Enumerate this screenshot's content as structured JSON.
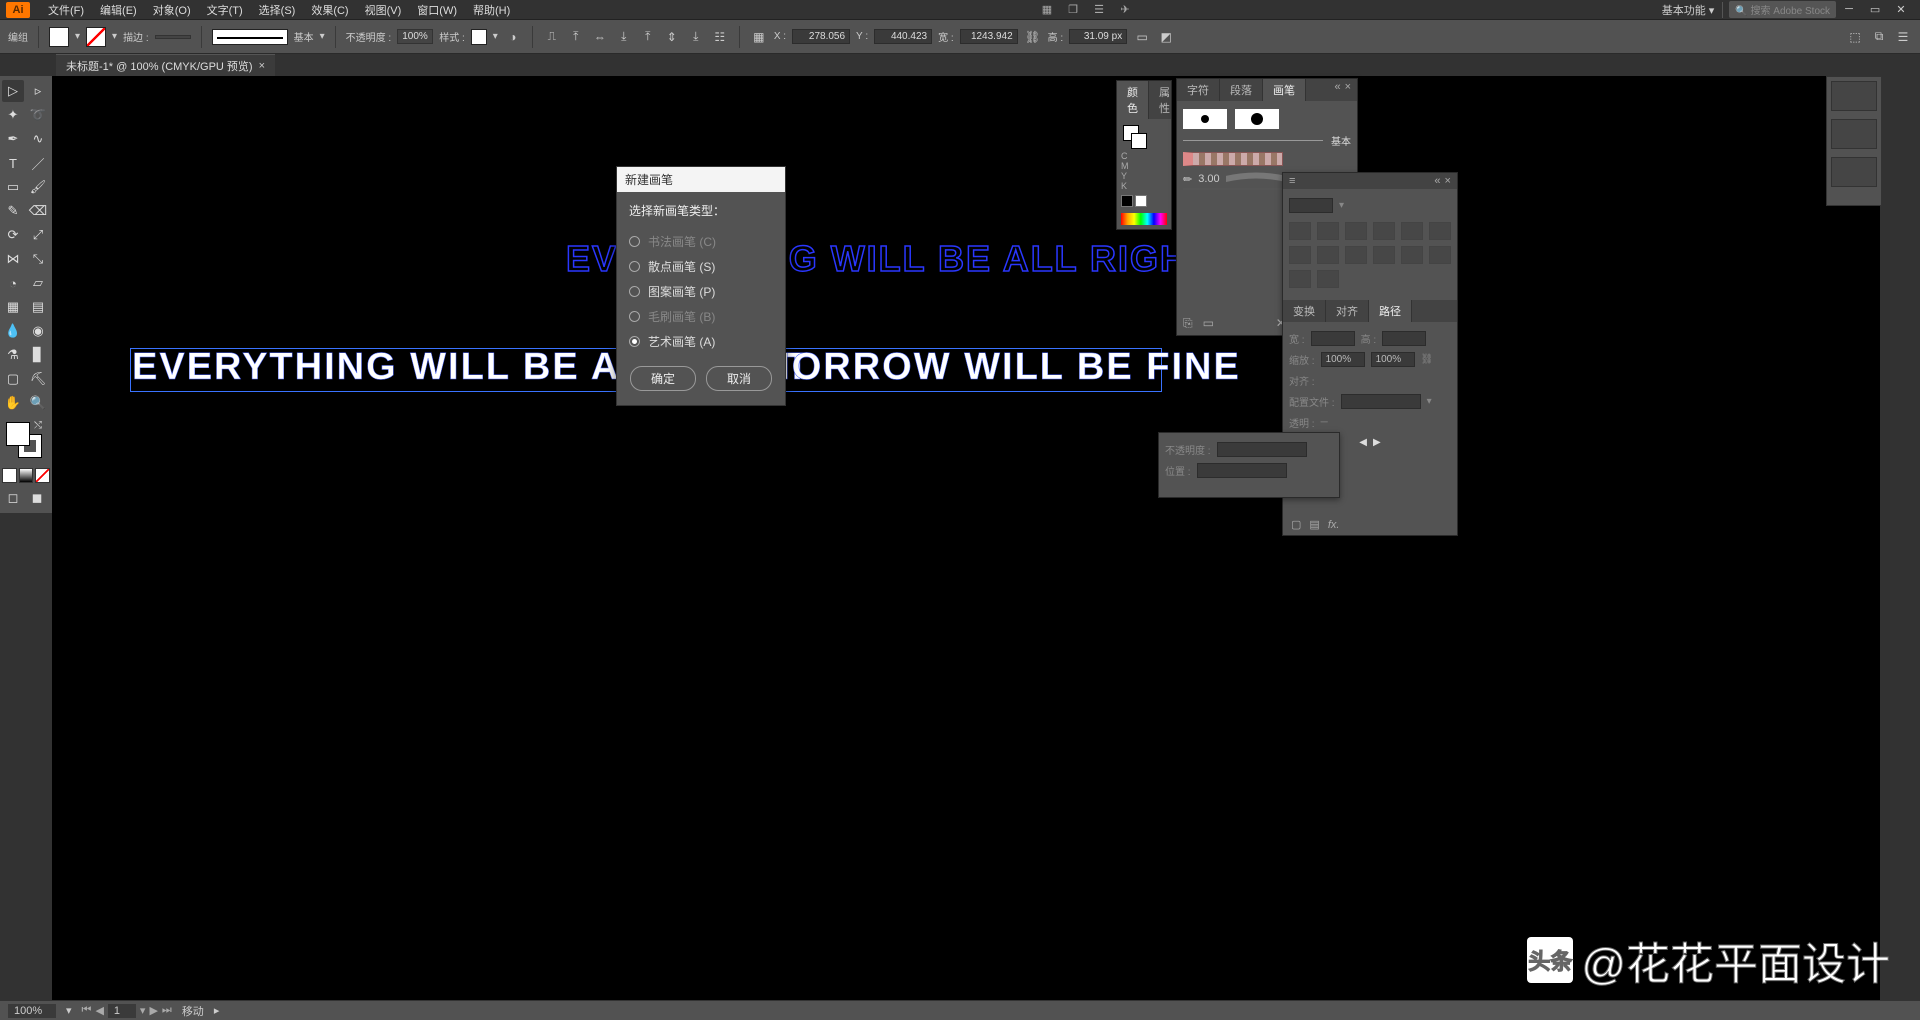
{
  "menubar": {
    "app": "Ai",
    "workspace": "基本功能",
    "searchPlaceholder": "搜索 Adobe Stock",
    "items": [
      "文件(F)",
      "编辑(E)",
      "对象(O)",
      "文字(T)",
      "选择(S)",
      "效果(C)",
      "视图(V)",
      "窗口(W)",
      "帮助(H)"
    ]
  },
  "controlbar": {
    "label": "编组",
    "strokeLabel": "描边 :",
    "strokeWidth": "",
    "brushLabel": "基本",
    "opacityLabel": "不透明度 :",
    "opacity": "100%",
    "styleLabel": "样式 :",
    "x": "X :",
    "xVal": "278.056",
    "y": "Y :",
    "yVal": "440.423",
    "w": "宽 :",
    "wVal": "1243.942",
    "h": "高 :",
    "hVal": "31.09 px"
  },
  "doc": {
    "tab": "未标题-1* @ 100% (CMYK/GPU 预览)"
  },
  "canvas": {
    "textOutline": "EVERYTHING WILL BE ALL RIGHT",
    "textSolidA": "EVERYTHING WILL BE ALL RIGHT",
    "textSolidB": "TOMORROW WILL BE FINE"
  },
  "dialog": {
    "title": "新建画笔",
    "prompt": "选择新画笔类型：",
    "options": [
      {
        "label": "书法画笔 (C)",
        "enabled": false,
        "checked": false
      },
      {
        "label": "散点画笔 (S)",
        "enabled": true,
        "checked": false
      },
      {
        "label": "图案画笔 (P)",
        "enabled": true,
        "checked": false
      },
      {
        "label": "毛刷画笔 (B)",
        "enabled": false,
        "checked": false
      },
      {
        "label": "艺术画笔 (A)",
        "enabled": true,
        "checked": true
      }
    ],
    "ok": "确定",
    "cancel": "取消"
  },
  "panels": {
    "color": {
      "tabs": [
        "颜色",
        "属性"
      ],
      "channels": [
        "C",
        "M",
        "Y",
        "K"
      ]
    },
    "brush": {
      "tabs": [
        "字符",
        "段落",
        "画笔"
      ],
      "basic": "基本",
      "cal": "3.00"
    },
    "transform": {
      "tabs": [
        "变换",
        "对齐",
        "路径"
      ],
      "opacity": "100%",
      "hund": "100%",
      "profile": "配置文件 :",
      "transparent": "透明 :",
      "dash": "─"
    },
    "panel2": {
      "labels": [
        "不透明度 :",
        "位置 :"
      ]
    }
  },
  "statusbar": {
    "zoom": "100%",
    "page": "1",
    "tool": "移动"
  },
  "watermark": {
    "brand": "头条",
    "handle": "@花花平面设计"
  }
}
